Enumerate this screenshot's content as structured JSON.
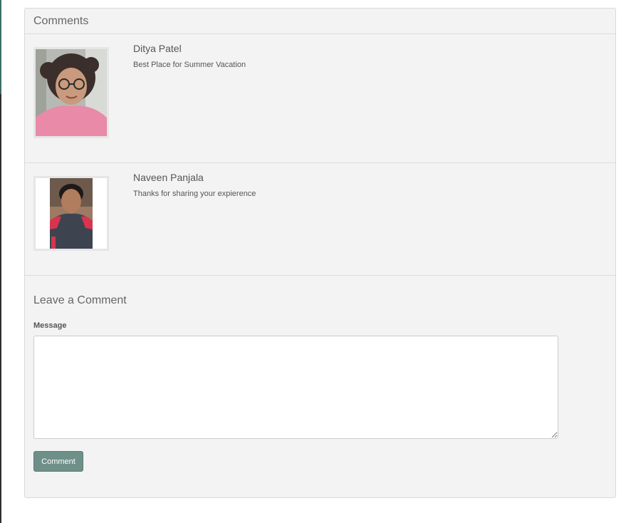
{
  "section": {
    "title": "Comments"
  },
  "comments": [
    {
      "name": "Ditya Patel",
      "text": "Best Place for Summer Vacation",
      "avatar": "child-with-glasses-photo"
    },
    {
      "name": "Naveen Panjala",
      "text": "Thanks for sharing your expierence",
      "avatar": "young-man-photo"
    }
  ],
  "form": {
    "title": "Leave a Comment",
    "message_label": "Message",
    "message_value": "",
    "submit_label": "Comment"
  },
  "colors": {
    "button": "#6e9089",
    "panel_bg": "#f3f3f3"
  }
}
